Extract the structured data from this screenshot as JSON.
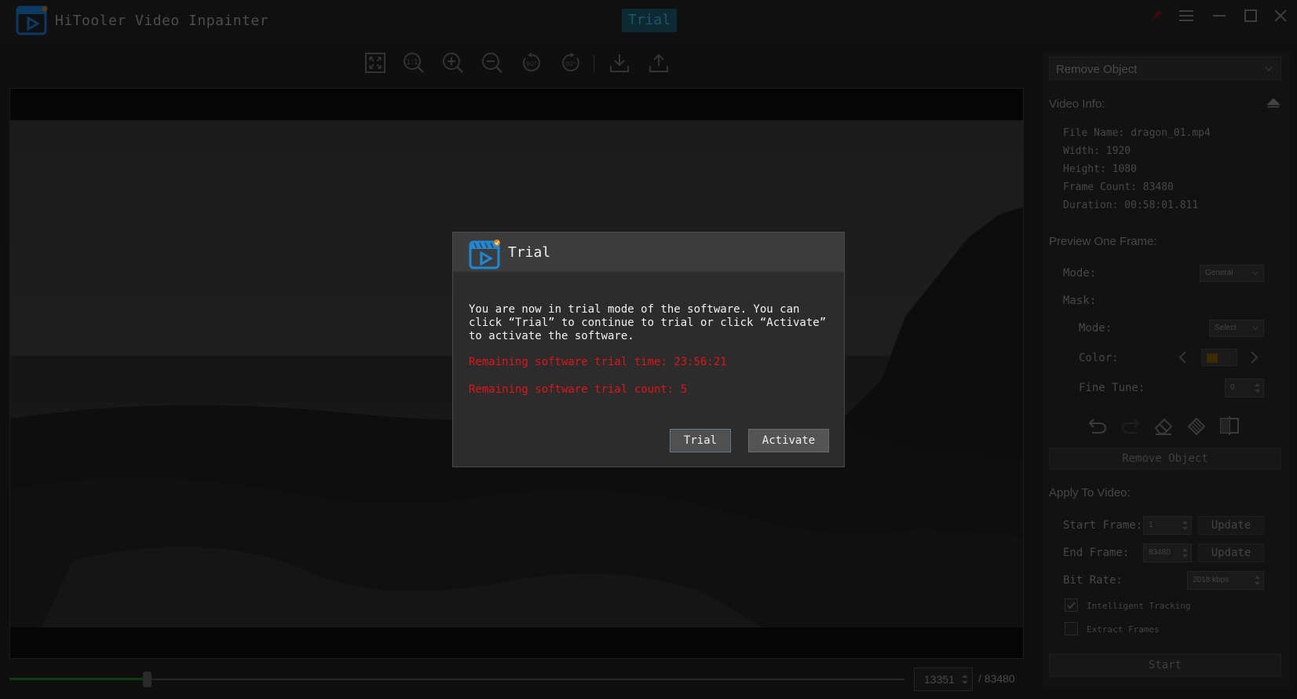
{
  "app": {
    "title": "HiTooler Video Inpainter",
    "trial_badge": "Trial"
  },
  "window_controls": [
    "pin-icon",
    "menu-icon",
    "minimize-icon",
    "maximize-icon",
    "close-icon"
  ],
  "toolbar": {
    "icons": [
      "fit-screen-icon",
      "original-size-icon",
      "zoom-in-icon",
      "zoom-out-icon",
      "rotate-left-90-icon",
      "rotate-right-90-icon",
      "import-icon",
      "export-icon"
    ],
    "rotate_label": "90°"
  },
  "timeline": {
    "current_frame": "13351",
    "total_frames": "/ 83480",
    "progress": 0.16
  },
  "panel": {
    "function_select": "Remove Object",
    "video_info": {
      "title": "Video Info:",
      "lines": [
        "File Name: dragon_01.mp4",
        "Width: 1920",
        "Height: 1080",
        "Frame Count: 83480",
        "Duration: 00:58:01.811"
      ]
    },
    "preview": {
      "title": "Preview One Frame:",
      "mode_label": "Mode:",
      "mode_value": "General",
      "mask_label": "Mask:",
      "mask_mode_label": "Mode:",
      "mask_mode_value": "Select",
      "color_label": "Color:",
      "fine_tune_label": "Fine Tune:",
      "fine_tune_value": "0",
      "remove_button": "Remove Object"
    },
    "apply": {
      "title": "Apply To Video:",
      "start_label": "Start Frame:",
      "start_value": "1",
      "end_label": "End Frame:",
      "end_value": "83480",
      "update_label": "Update",
      "bitrate_label": "Bit Rate:",
      "bitrate_value": "2018 kbps",
      "tracking_label": "Intelligent Tracking",
      "tracking_checked": true,
      "extract_label": "Extract Frames",
      "extract_checked": false,
      "start_button": "Start"
    }
  },
  "dialog": {
    "title": "Trial",
    "message": "You are now in trial mode of the software. You can click “Trial” to continue to trial or click “Activate” to activate the software.",
    "time_line": "Remaining software trial time: 23:56:21",
    "count_line": "Remaining software trial count: 5",
    "trial_button": "Trial",
    "activate_button": "Activate"
  },
  "colors": {
    "accent": "#1f87d6",
    "warning": "#e2141a",
    "mask_color": "#c28600",
    "progress": "#0f6a1a"
  }
}
